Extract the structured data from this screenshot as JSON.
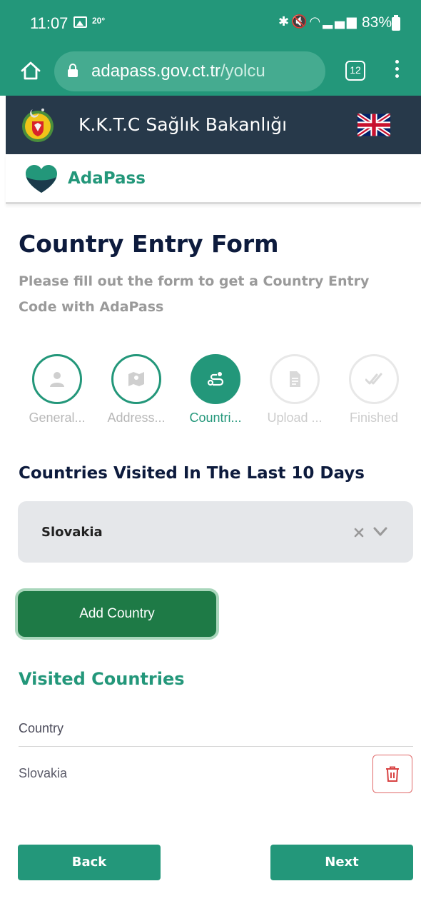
{
  "status_bar": {
    "time": "11:07",
    "temperature": "20°",
    "battery": "83%",
    "icons": [
      "gallery-icon",
      "bluetooth-icon",
      "mute-icon",
      "wifi-icon",
      "signal-icon",
      "volte-icon",
      "battery-icon"
    ]
  },
  "browser": {
    "url_host": "adapass.gov.ct.tr",
    "url_path": "/yolcu",
    "tab_count": "12"
  },
  "header": {
    "ministry_title": "K.K.T.C Sağlık Bakanlığı",
    "brand_name": "AdaPass"
  },
  "form": {
    "title": "Country Entry Form",
    "subtitle": "Please fill out the form to get a Country Entry Code with AdaPass"
  },
  "steps": [
    {
      "label": "General...",
      "state": "done",
      "icon": "person-icon"
    },
    {
      "label": "Address...",
      "state": "done",
      "icon": "map-icon"
    },
    {
      "label": "Countri...",
      "state": "active",
      "icon": "route-icon"
    },
    {
      "label": "Upload ...",
      "state": "pending",
      "icon": "document-icon"
    },
    {
      "label": "Finished",
      "state": "pending",
      "icon": "double-check-icon"
    }
  ],
  "countries_section": {
    "title": "Countries Visited In The Last 10 Days",
    "selected_value": "Slovakia",
    "add_button": "Add Country"
  },
  "visited": {
    "title": "Visited Countries",
    "column_header": "Country",
    "rows": [
      {
        "country": "Slovakia"
      }
    ]
  },
  "navigation": {
    "back": "Back",
    "next": "Next"
  },
  "colors": {
    "primary": "#23977a",
    "header_dark": "#27394a",
    "title_navy": "#0d1b3d",
    "add_button": "#1e7a46",
    "delete_red": "#d84343"
  }
}
